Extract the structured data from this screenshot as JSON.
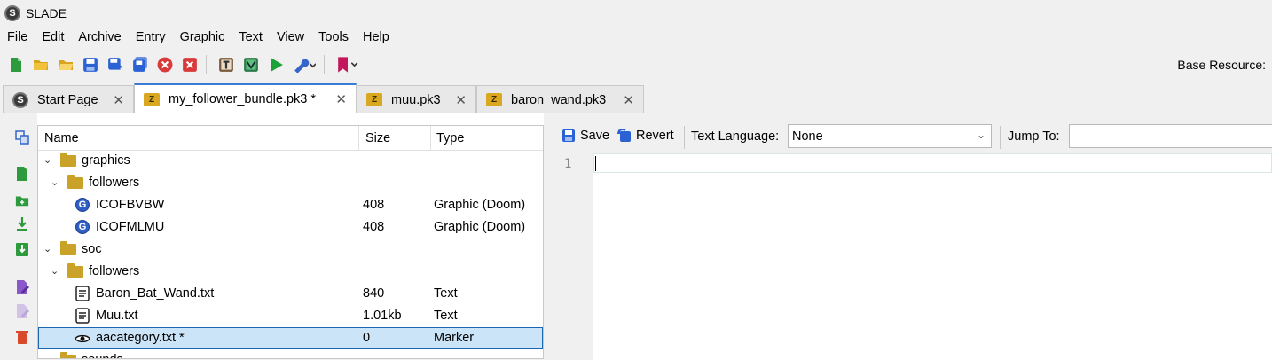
{
  "window": {
    "title": "SLADE"
  },
  "menu": [
    "File",
    "Edit",
    "Archive",
    "Entry",
    "Graphic",
    "Text",
    "View",
    "Tools",
    "Help"
  ],
  "toolbar": {
    "icons": [
      "new-archive-icon",
      "open-archive-icon",
      "open-directory-icon",
      "save-icon",
      "save-as-icon",
      "save-all-icon",
      "close-archive-icon",
      "close-all-icon",
      "text-editor-icon",
      "map-editor-icon",
      "run-icon",
      "tools-icon",
      "bookmark-icon"
    ],
    "base_resource_label": "Base Resource:"
  },
  "tabs": [
    {
      "label": "Start Page",
      "icon": "slade-icon"
    },
    {
      "label": "my_follower_bundle.pk3 *",
      "icon": "pk3-icon"
    },
    {
      "label": "muu.pk3",
      "icon": "pk3-icon"
    },
    {
      "label": "baron_wand.pk3",
      "icon": "pk3-icon"
    }
  ],
  "tree": {
    "headers": {
      "name": "Name",
      "size": "Size",
      "type": "Type"
    },
    "rows": [
      {
        "name": "graphics",
        "size": "",
        "type": "",
        "icon": "folder-icon",
        "expanded": true
      },
      {
        "name": "followers",
        "size": "",
        "type": "",
        "icon": "folder-icon",
        "expanded": true
      },
      {
        "name": "ICOFBVBW",
        "size": "408",
        "type": "Graphic (Doom)",
        "icon": "graphic-icon"
      },
      {
        "name": "ICOFMLMU",
        "size": "408",
        "type": "Graphic (Doom)",
        "icon": "graphic-icon"
      },
      {
        "name": "soc",
        "size": "",
        "type": "",
        "icon": "folder-icon",
        "expanded": true
      },
      {
        "name": "followers",
        "size": "",
        "type": "",
        "icon": "folder-icon",
        "expanded": true
      },
      {
        "name": "Baron_Bat_Wand.txt",
        "size": "840",
        "type": "Text",
        "icon": "text-file-icon"
      },
      {
        "name": "Muu.txt",
        "size": "1.01kb",
        "type": "Text",
        "icon": "text-file-icon"
      },
      {
        "name": "aacategory.txt *",
        "size": "0",
        "type": "Marker",
        "icon": "marker-icon",
        "selected": true
      },
      {
        "name": "sounds",
        "size": "",
        "type": "",
        "icon": "folder-icon"
      }
    ]
  },
  "editor": {
    "save_label": "Save",
    "revert_label": "Revert",
    "text_language_label": "Text Language:",
    "text_language_value": "None",
    "jump_to_label": "Jump To:",
    "line_number": "1"
  },
  "colors": {
    "accent": "#3a7bd5",
    "selection": "#cce4f7",
    "folder": "#c9a227"
  }
}
